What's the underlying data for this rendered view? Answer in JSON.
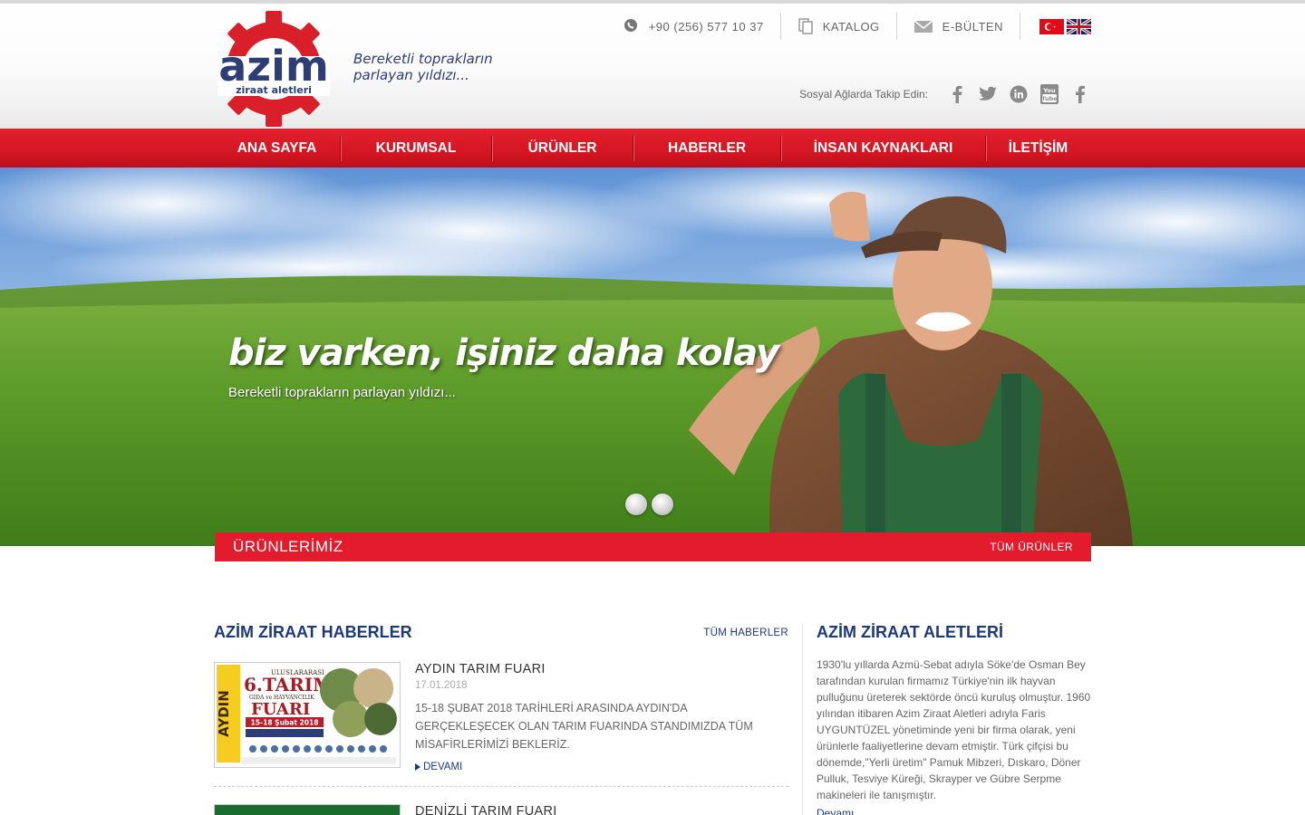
{
  "brand": {
    "name": "azim",
    "sub": "ziraat aletleri",
    "slogan_line1": "Bereketli toprakların",
    "slogan_line2": "parlayan yıldızı..."
  },
  "topbar": {
    "phone": "+90 (256) 577 10 37",
    "catalog": "KATALOG",
    "newsletter": "E-BÜLTEN"
  },
  "social": {
    "label": "Sosyal Ağlarda Takip Edin:",
    "icons": [
      "facebook-icon",
      "twitter-icon",
      "linkedin-icon",
      "youtube-icon",
      "facebook-icon"
    ]
  },
  "nav": {
    "items": [
      "ANA SAYFA",
      "KURUMSAL",
      "ÜRÜNLER",
      "HABERLER",
      "İNSAN KAYNAKLARI",
      "İLETİŞİM"
    ]
  },
  "hero": {
    "title": "biz varken, işiniz daha kolay",
    "subtitle": "Bereketli toprakların parlayan yıldızı..."
  },
  "products": {
    "title": "ÜRÜNLERİMİZ",
    "link": "TÜM ÜRÜNLER"
  },
  "news": {
    "title": "AZİM ZİRAAT HABERLER",
    "link": "TÜM HABERLER",
    "items": [
      {
        "title": "AYDIN TARIM FUARI",
        "date": "17.01.2018",
        "text": "15-18 ŞUBAT 2018 TARİHLERİ ARASINDA AYDIN'DA GERÇEKLEŞECEK OLAN TARIM FUARINDA STANDIMIZDA TÜM MİSAFİRLERİMİZİ BEKLERİZ.",
        "more": "DEVAMI",
        "thumb": {
          "side": "AYDIN",
          "l1": "ULUSLARARASI",
          "l2": "6.TARIM",
          "l3": "GIDA ve HAYVANCILIK",
          "l4": "FUARI",
          "l5": "15-18 Şubat 2018"
        }
      },
      {
        "title": "DENİZLİ TARIM FUARI"
      }
    ]
  },
  "about": {
    "title": "AZİM ZİRAAT ALETLERİ",
    "text": "1930'lu yıllarda Azmü-Sebat adıyla Söke'de Osman Bey tarafından kurulan firmamız Türkiye'nin ilk hayvan pulluğunu üreterek sektörde öncü kuruluş olmuştur. 1960 yılından itibaren Azim Ziraat Aletleri adıyla Faris UYGUNTÜZEL yönetiminde yeni bir firma olarak, yeni ürünlerle faaliyetlerine devam etmiştir. Türk çifçisi bu dönemde,\"Yerli üretim\" Pamuk Mibzeri, Dıskaro, Döner Pulluk, Tesviye Küreği, Skrayper ve Gübre Serpme makineleri ile tanışmıştır.",
    "more": "Devamı"
  },
  "colors": {
    "brand_red": "#e21c2c",
    "brand_navy": "#1c3a7a"
  }
}
